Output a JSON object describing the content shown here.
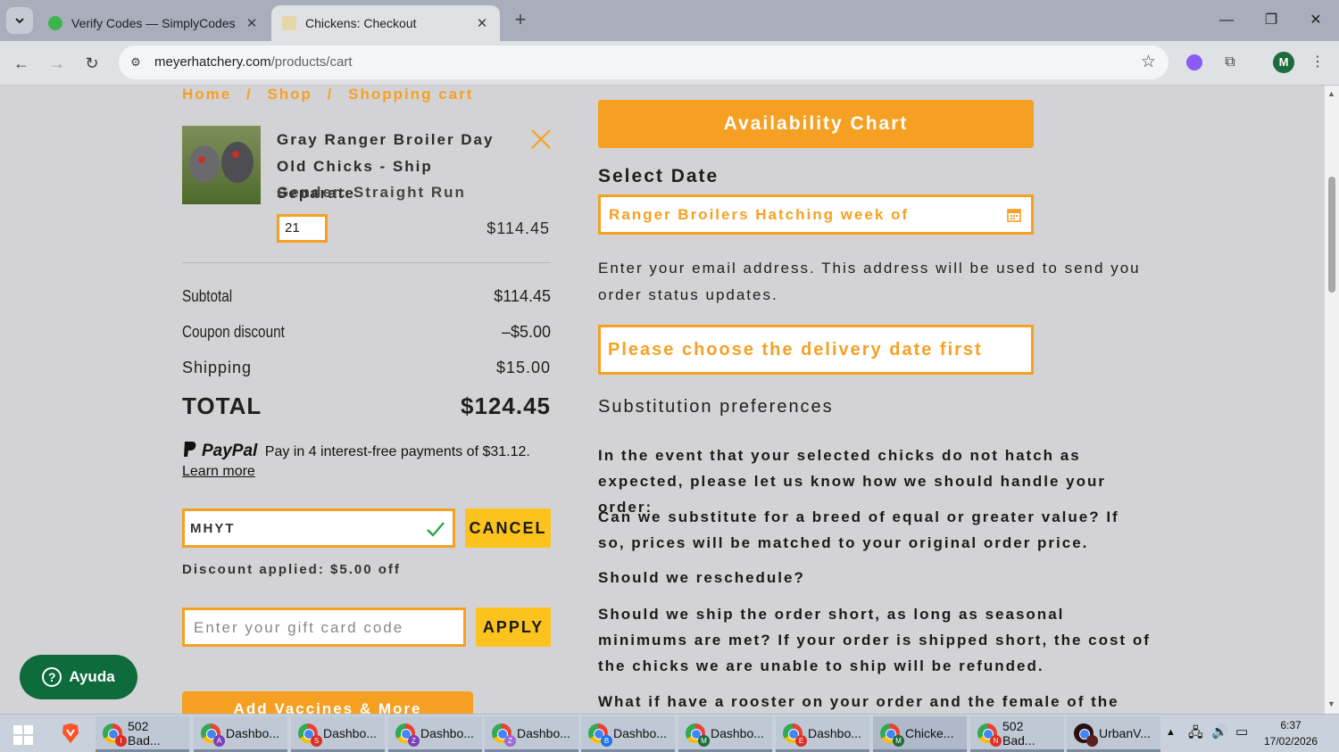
{
  "browser": {
    "tabs": [
      {
        "title": "Verify Codes — SimplyCodes",
        "active": false
      },
      {
        "title": "Chickens: Checkout",
        "active": true
      }
    ],
    "url_domain": "meyerhatchery.com",
    "url_path": "/products/cart",
    "avatar_letter": "M"
  },
  "breadcrumb": [
    "Home",
    "/",
    "Shop",
    "/",
    "Shopping cart"
  ],
  "cart_item": {
    "name": "Gray Ranger Broiler Day Old Chicks - Ship Separate",
    "gender": "Gender: Straight Run",
    "quantity": "21",
    "price": "$114.45"
  },
  "summary": {
    "subtotal_label": "Subtotal",
    "subtotal_value": "$114.45",
    "coupon_label": "Coupon discount",
    "coupon_value": "–$5.00",
    "shipping_label": "Shipping",
    "shipping_value": "$15.00",
    "total_label": "TOTAL",
    "total_value": "$124.45"
  },
  "paypal": {
    "brand": "PayPal",
    "message": "Pay in 4 interest-free payments of $31.12.",
    "link": "Learn more"
  },
  "coupon": {
    "value": "MHYT",
    "cancel_label": "CANCEL",
    "discount_message": "Discount applied: $5.00 off"
  },
  "gift_card": {
    "placeholder": "Enter your gift card code",
    "apply_label": "APPLY"
  },
  "add_vaccines_label": "Add Vaccines & More",
  "right": {
    "availability_label": "Availability Chart",
    "select_date_heading": "Select Date",
    "date_value": "Ranger Broilers Hatching week of",
    "email_help": "Enter your email address. This address will be used to send you order status updates.",
    "email_placeholder": "Please choose the delivery date first",
    "subst_heading": "Substitution preferences",
    "subst_intro": "In the event that your selected chicks do not hatch as expected, please let us know how we should handle your order:",
    "q1": "Can we substitute for a breed of equal or greater value? If so, prices will be matched to your original order price.",
    "q2": "Should we reschedule?",
    "q3": "Should we ship the order short, as long as seasonal minimums are met? If your order is shipped short, the cost of the chicks we are unable to ship will be refunded.",
    "q4": "What if have a rooster on your order and the female of the same"
  },
  "help_button": "Ayuda",
  "taskbar": {
    "apps": [
      {
        "label": "502 Bad...",
        "badge": "I",
        "badge_color": "#d93025"
      },
      {
        "label": "Dashbo...",
        "badge": "A",
        "badge_color": "#7b3fb8"
      },
      {
        "label": "Dashbo...",
        "badge": "S",
        "badge_color": "#d93025"
      },
      {
        "label": "Dashbo...",
        "badge": "Z",
        "badge_color": "#7b3fb8"
      },
      {
        "label": "Dashbo...",
        "badge": "Z",
        "badge_color": "#9c6ad6"
      },
      {
        "label": "Dashbo...",
        "badge": "B",
        "badge_color": "#1a73e8"
      },
      {
        "label": "Dashbo...",
        "badge": "M",
        "badge_color": "#1e6b3e"
      },
      {
        "label": "Dashbo...",
        "badge": "E",
        "badge_color": "#d93025"
      },
      {
        "label": "Chicke...",
        "badge": "M",
        "badge_color": "#1e6b3e"
      },
      {
        "label": "502 Bad...",
        "badge": "N",
        "badge_color": "#d93025"
      },
      {
        "label": "UrbanV...",
        "badge": "",
        "badge_color": "#5a1f1f"
      }
    ],
    "time": "6:37",
    "date": "17/02/2026"
  },
  "colors": {
    "accent_orange": "#f6a023",
    "button_yellow": "#fcc31e",
    "help_green": "#0d6b3c"
  }
}
